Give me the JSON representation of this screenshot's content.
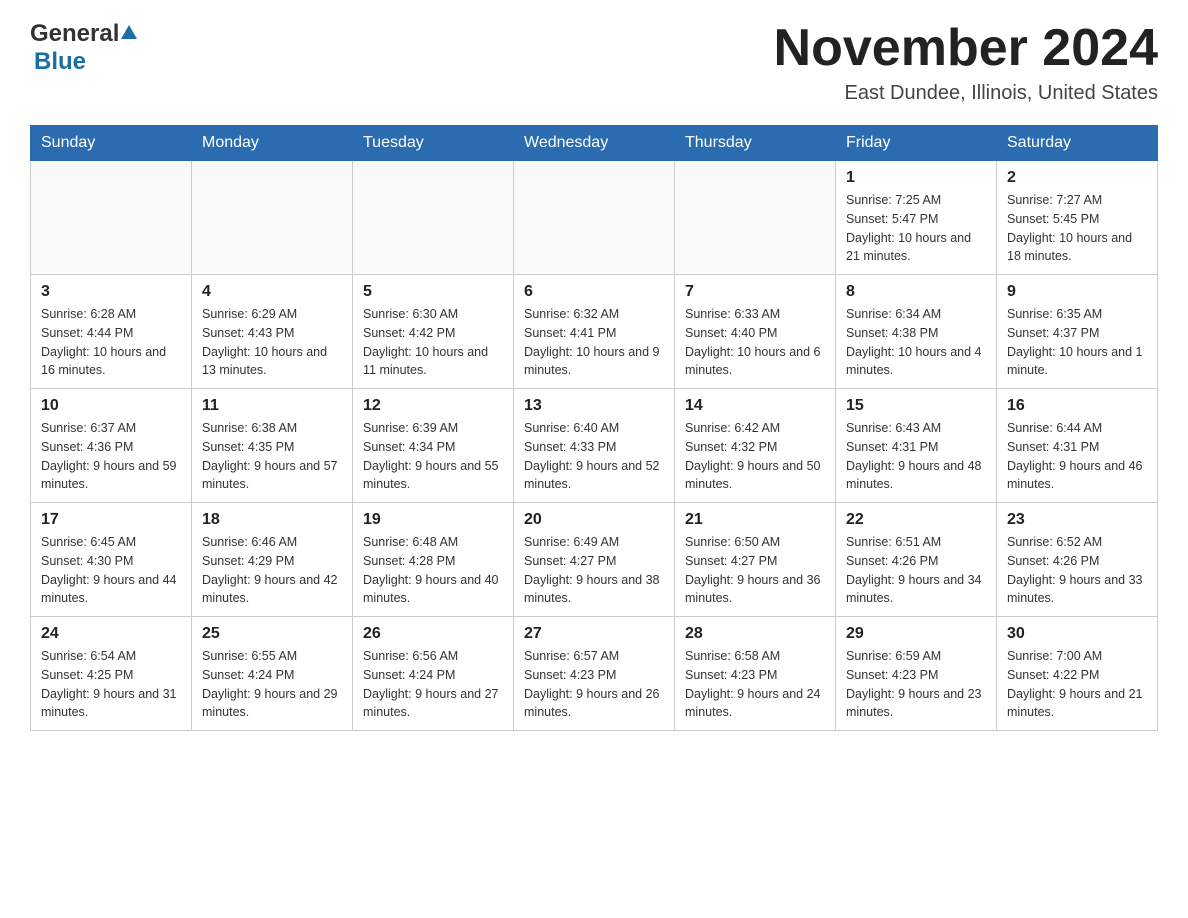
{
  "header": {
    "logo_general": "General",
    "logo_blue": "Blue",
    "month_title": "November 2024",
    "location": "East Dundee, Illinois, United States"
  },
  "weekdays": [
    "Sunday",
    "Monday",
    "Tuesday",
    "Wednesday",
    "Thursday",
    "Friday",
    "Saturday"
  ],
  "weeks": [
    [
      {
        "day": "",
        "sunrise": "",
        "sunset": "",
        "daylight": ""
      },
      {
        "day": "",
        "sunrise": "",
        "sunset": "",
        "daylight": ""
      },
      {
        "day": "",
        "sunrise": "",
        "sunset": "",
        "daylight": ""
      },
      {
        "day": "",
        "sunrise": "",
        "sunset": "",
        "daylight": ""
      },
      {
        "day": "",
        "sunrise": "",
        "sunset": "",
        "daylight": ""
      },
      {
        "day": "1",
        "sunrise": "Sunrise: 7:25 AM",
        "sunset": "Sunset: 5:47 PM",
        "daylight": "Daylight: 10 hours and 21 minutes."
      },
      {
        "day": "2",
        "sunrise": "Sunrise: 7:27 AM",
        "sunset": "Sunset: 5:45 PM",
        "daylight": "Daylight: 10 hours and 18 minutes."
      }
    ],
    [
      {
        "day": "3",
        "sunrise": "Sunrise: 6:28 AM",
        "sunset": "Sunset: 4:44 PM",
        "daylight": "Daylight: 10 hours and 16 minutes."
      },
      {
        "day": "4",
        "sunrise": "Sunrise: 6:29 AM",
        "sunset": "Sunset: 4:43 PM",
        "daylight": "Daylight: 10 hours and 13 minutes."
      },
      {
        "day": "5",
        "sunrise": "Sunrise: 6:30 AM",
        "sunset": "Sunset: 4:42 PM",
        "daylight": "Daylight: 10 hours and 11 minutes."
      },
      {
        "day": "6",
        "sunrise": "Sunrise: 6:32 AM",
        "sunset": "Sunset: 4:41 PM",
        "daylight": "Daylight: 10 hours and 9 minutes."
      },
      {
        "day": "7",
        "sunrise": "Sunrise: 6:33 AM",
        "sunset": "Sunset: 4:40 PM",
        "daylight": "Daylight: 10 hours and 6 minutes."
      },
      {
        "day": "8",
        "sunrise": "Sunrise: 6:34 AM",
        "sunset": "Sunset: 4:38 PM",
        "daylight": "Daylight: 10 hours and 4 minutes."
      },
      {
        "day": "9",
        "sunrise": "Sunrise: 6:35 AM",
        "sunset": "Sunset: 4:37 PM",
        "daylight": "Daylight: 10 hours and 1 minute."
      }
    ],
    [
      {
        "day": "10",
        "sunrise": "Sunrise: 6:37 AM",
        "sunset": "Sunset: 4:36 PM",
        "daylight": "Daylight: 9 hours and 59 minutes."
      },
      {
        "day": "11",
        "sunrise": "Sunrise: 6:38 AM",
        "sunset": "Sunset: 4:35 PM",
        "daylight": "Daylight: 9 hours and 57 minutes."
      },
      {
        "day": "12",
        "sunrise": "Sunrise: 6:39 AM",
        "sunset": "Sunset: 4:34 PM",
        "daylight": "Daylight: 9 hours and 55 minutes."
      },
      {
        "day": "13",
        "sunrise": "Sunrise: 6:40 AM",
        "sunset": "Sunset: 4:33 PM",
        "daylight": "Daylight: 9 hours and 52 minutes."
      },
      {
        "day": "14",
        "sunrise": "Sunrise: 6:42 AM",
        "sunset": "Sunset: 4:32 PM",
        "daylight": "Daylight: 9 hours and 50 minutes."
      },
      {
        "day": "15",
        "sunrise": "Sunrise: 6:43 AM",
        "sunset": "Sunset: 4:31 PM",
        "daylight": "Daylight: 9 hours and 48 minutes."
      },
      {
        "day": "16",
        "sunrise": "Sunrise: 6:44 AM",
        "sunset": "Sunset: 4:31 PM",
        "daylight": "Daylight: 9 hours and 46 minutes."
      }
    ],
    [
      {
        "day": "17",
        "sunrise": "Sunrise: 6:45 AM",
        "sunset": "Sunset: 4:30 PM",
        "daylight": "Daylight: 9 hours and 44 minutes."
      },
      {
        "day": "18",
        "sunrise": "Sunrise: 6:46 AM",
        "sunset": "Sunset: 4:29 PM",
        "daylight": "Daylight: 9 hours and 42 minutes."
      },
      {
        "day": "19",
        "sunrise": "Sunrise: 6:48 AM",
        "sunset": "Sunset: 4:28 PM",
        "daylight": "Daylight: 9 hours and 40 minutes."
      },
      {
        "day": "20",
        "sunrise": "Sunrise: 6:49 AM",
        "sunset": "Sunset: 4:27 PM",
        "daylight": "Daylight: 9 hours and 38 minutes."
      },
      {
        "day": "21",
        "sunrise": "Sunrise: 6:50 AM",
        "sunset": "Sunset: 4:27 PM",
        "daylight": "Daylight: 9 hours and 36 minutes."
      },
      {
        "day": "22",
        "sunrise": "Sunrise: 6:51 AM",
        "sunset": "Sunset: 4:26 PM",
        "daylight": "Daylight: 9 hours and 34 minutes."
      },
      {
        "day": "23",
        "sunrise": "Sunrise: 6:52 AM",
        "sunset": "Sunset: 4:26 PM",
        "daylight": "Daylight: 9 hours and 33 minutes."
      }
    ],
    [
      {
        "day": "24",
        "sunrise": "Sunrise: 6:54 AM",
        "sunset": "Sunset: 4:25 PM",
        "daylight": "Daylight: 9 hours and 31 minutes."
      },
      {
        "day": "25",
        "sunrise": "Sunrise: 6:55 AM",
        "sunset": "Sunset: 4:24 PM",
        "daylight": "Daylight: 9 hours and 29 minutes."
      },
      {
        "day": "26",
        "sunrise": "Sunrise: 6:56 AM",
        "sunset": "Sunset: 4:24 PM",
        "daylight": "Daylight: 9 hours and 27 minutes."
      },
      {
        "day": "27",
        "sunrise": "Sunrise: 6:57 AM",
        "sunset": "Sunset: 4:23 PM",
        "daylight": "Daylight: 9 hours and 26 minutes."
      },
      {
        "day": "28",
        "sunrise": "Sunrise: 6:58 AM",
        "sunset": "Sunset: 4:23 PM",
        "daylight": "Daylight: 9 hours and 24 minutes."
      },
      {
        "day": "29",
        "sunrise": "Sunrise: 6:59 AM",
        "sunset": "Sunset: 4:23 PM",
        "daylight": "Daylight: 9 hours and 23 minutes."
      },
      {
        "day": "30",
        "sunrise": "Sunrise: 7:00 AM",
        "sunset": "Sunset: 4:22 PM",
        "daylight": "Daylight: 9 hours and 21 minutes."
      }
    ]
  ]
}
